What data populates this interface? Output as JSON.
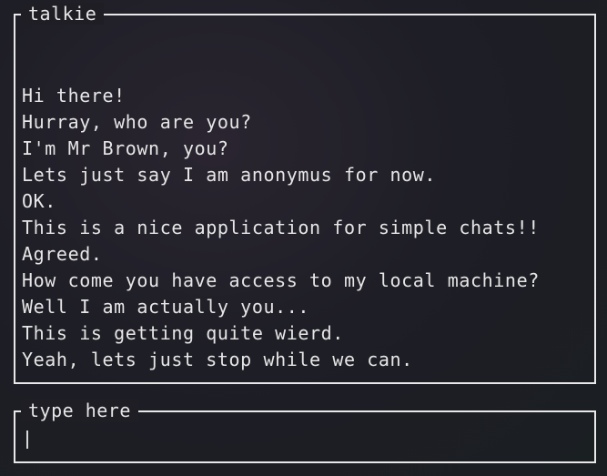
{
  "chat": {
    "title": "talkie",
    "messages": [
      "Hi there!",
      "Hurray, who are you?",
      "I'm Mr Brown, you?",
      "Lets just say I am anonymus for now.",
      "OK.",
      "This is a nice application for simple chats!!",
      "Agreed.",
      "How come you have access to my local machine?",
      "Well I am actually you...",
      "This is getting quite wierd.",
      "Yeah, lets just stop while we can."
    ]
  },
  "input": {
    "title": "type here",
    "value": ""
  },
  "colors": {
    "border": "#e8e8e8",
    "text": "#e6e6e6",
    "background": "#1f1e25"
  }
}
